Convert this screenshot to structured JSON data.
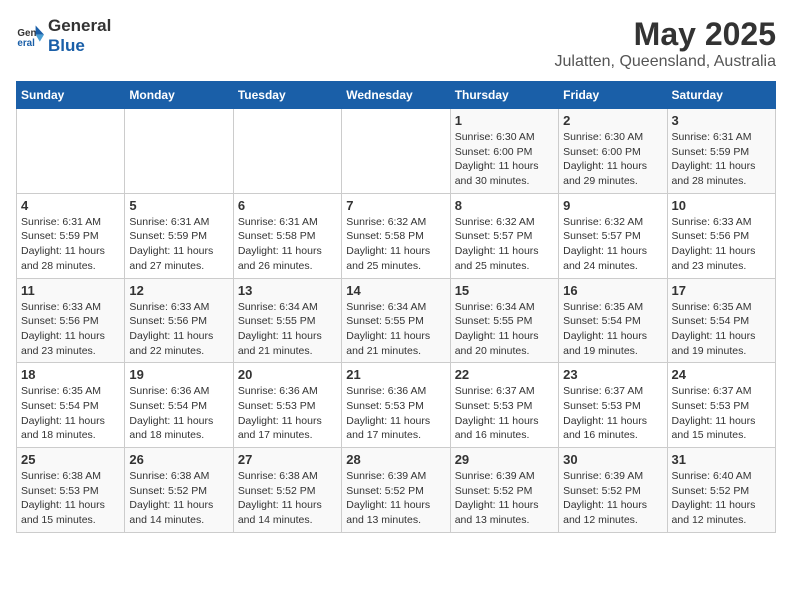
{
  "logo": {
    "general": "General",
    "blue": "Blue"
  },
  "header": {
    "month": "May 2025",
    "location": "Julatten, Queensland, Australia"
  },
  "days_of_week": [
    "Sunday",
    "Monday",
    "Tuesday",
    "Wednesday",
    "Thursday",
    "Friday",
    "Saturday"
  ],
  "weeks": [
    [
      {
        "day": "",
        "info": ""
      },
      {
        "day": "",
        "info": ""
      },
      {
        "day": "",
        "info": ""
      },
      {
        "day": "",
        "info": ""
      },
      {
        "day": "1",
        "info": "Sunrise: 6:30 AM\nSunset: 6:00 PM\nDaylight: 11 hours\nand 30 minutes."
      },
      {
        "day": "2",
        "info": "Sunrise: 6:30 AM\nSunset: 6:00 PM\nDaylight: 11 hours\nand 29 minutes."
      },
      {
        "day": "3",
        "info": "Sunrise: 6:31 AM\nSunset: 5:59 PM\nDaylight: 11 hours\nand 28 minutes."
      }
    ],
    [
      {
        "day": "4",
        "info": "Sunrise: 6:31 AM\nSunset: 5:59 PM\nDaylight: 11 hours\nand 28 minutes."
      },
      {
        "day": "5",
        "info": "Sunrise: 6:31 AM\nSunset: 5:59 PM\nDaylight: 11 hours\nand 27 minutes."
      },
      {
        "day": "6",
        "info": "Sunrise: 6:31 AM\nSunset: 5:58 PM\nDaylight: 11 hours\nand 26 minutes."
      },
      {
        "day": "7",
        "info": "Sunrise: 6:32 AM\nSunset: 5:58 PM\nDaylight: 11 hours\nand 25 minutes."
      },
      {
        "day": "8",
        "info": "Sunrise: 6:32 AM\nSunset: 5:57 PM\nDaylight: 11 hours\nand 25 minutes."
      },
      {
        "day": "9",
        "info": "Sunrise: 6:32 AM\nSunset: 5:57 PM\nDaylight: 11 hours\nand 24 minutes."
      },
      {
        "day": "10",
        "info": "Sunrise: 6:33 AM\nSunset: 5:56 PM\nDaylight: 11 hours\nand 23 minutes."
      }
    ],
    [
      {
        "day": "11",
        "info": "Sunrise: 6:33 AM\nSunset: 5:56 PM\nDaylight: 11 hours\nand 23 minutes."
      },
      {
        "day": "12",
        "info": "Sunrise: 6:33 AM\nSunset: 5:56 PM\nDaylight: 11 hours\nand 22 minutes."
      },
      {
        "day": "13",
        "info": "Sunrise: 6:34 AM\nSunset: 5:55 PM\nDaylight: 11 hours\nand 21 minutes."
      },
      {
        "day": "14",
        "info": "Sunrise: 6:34 AM\nSunset: 5:55 PM\nDaylight: 11 hours\nand 21 minutes."
      },
      {
        "day": "15",
        "info": "Sunrise: 6:34 AM\nSunset: 5:55 PM\nDaylight: 11 hours\nand 20 minutes."
      },
      {
        "day": "16",
        "info": "Sunrise: 6:35 AM\nSunset: 5:54 PM\nDaylight: 11 hours\nand 19 minutes."
      },
      {
        "day": "17",
        "info": "Sunrise: 6:35 AM\nSunset: 5:54 PM\nDaylight: 11 hours\nand 19 minutes."
      }
    ],
    [
      {
        "day": "18",
        "info": "Sunrise: 6:35 AM\nSunset: 5:54 PM\nDaylight: 11 hours\nand 18 minutes."
      },
      {
        "day": "19",
        "info": "Sunrise: 6:36 AM\nSunset: 5:54 PM\nDaylight: 11 hours\nand 18 minutes."
      },
      {
        "day": "20",
        "info": "Sunrise: 6:36 AM\nSunset: 5:53 PM\nDaylight: 11 hours\nand 17 minutes."
      },
      {
        "day": "21",
        "info": "Sunrise: 6:36 AM\nSunset: 5:53 PM\nDaylight: 11 hours\nand 17 minutes."
      },
      {
        "day": "22",
        "info": "Sunrise: 6:37 AM\nSunset: 5:53 PM\nDaylight: 11 hours\nand 16 minutes."
      },
      {
        "day": "23",
        "info": "Sunrise: 6:37 AM\nSunset: 5:53 PM\nDaylight: 11 hours\nand 16 minutes."
      },
      {
        "day": "24",
        "info": "Sunrise: 6:37 AM\nSunset: 5:53 PM\nDaylight: 11 hours\nand 15 minutes."
      }
    ],
    [
      {
        "day": "25",
        "info": "Sunrise: 6:38 AM\nSunset: 5:53 PM\nDaylight: 11 hours\nand 15 minutes."
      },
      {
        "day": "26",
        "info": "Sunrise: 6:38 AM\nSunset: 5:52 PM\nDaylight: 11 hours\nand 14 minutes."
      },
      {
        "day": "27",
        "info": "Sunrise: 6:38 AM\nSunset: 5:52 PM\nDaylight: 11 hours\nand 14 minutes."
      },
      {
        "day": "28",
        "info": "Sunrise: 6:39 AM\nSunset: 5:52 PM\nDaylight: 11 hours\nand 13 minutes."
      },
      {
        "day": "29",
        "info": "Sunrise: 6:39 AM\nSunset: 5:52 PM\nDaylight: 11 hours\nand 13 minutes."
      },
      {
        "day": "30",
        "info": "Sunrise: 6:39 AM\nSunset: 5:52 PM\nDaylight: 11 hours\nand 12 minutes."
      },
      {
        "day": "31",
        "info": "Sunrise: 6:40 AM\nSunset: 5:52 PM\nDaylight: 11 hours\nand 12 minutes."
      }
    ]
  ]
}
